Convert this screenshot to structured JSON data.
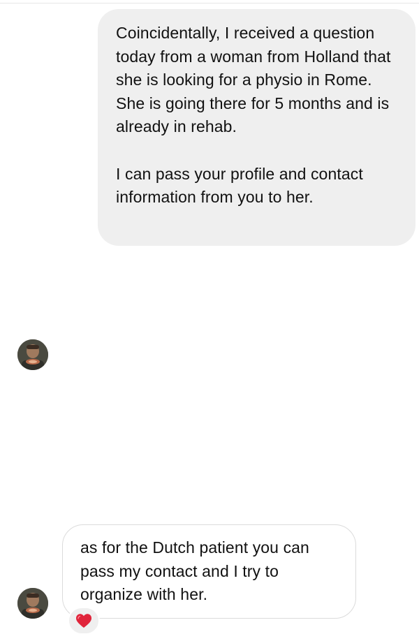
{
  "conversation": {
    "messages": [
      {
        "direction": "outgoing",
        "paragraphs": [
          "Coincidentally, I received a question today from a woman from Holland that she is looking for a physio in Rome. She is going there for 5 months and is already in rehab.",
          "I can pass your profile and contact information from you to her."
        ]
      },
      {
        "direction": "incoming",
        "avatar": "profile-photo"
      },
      {
        "direction": "incoming",
        "avatar": "profile-photo",
        "text": "as for the Dutch patient you can pass my contact and I try to organize with her.",
        "reaction": "heart"
      }
    ]
  },
  "colors": {
    "outgoing_bubble": "#efefef",
    "incoming_border": "#dbdbdb",
    "heart": "#e0243a"
  }
}
